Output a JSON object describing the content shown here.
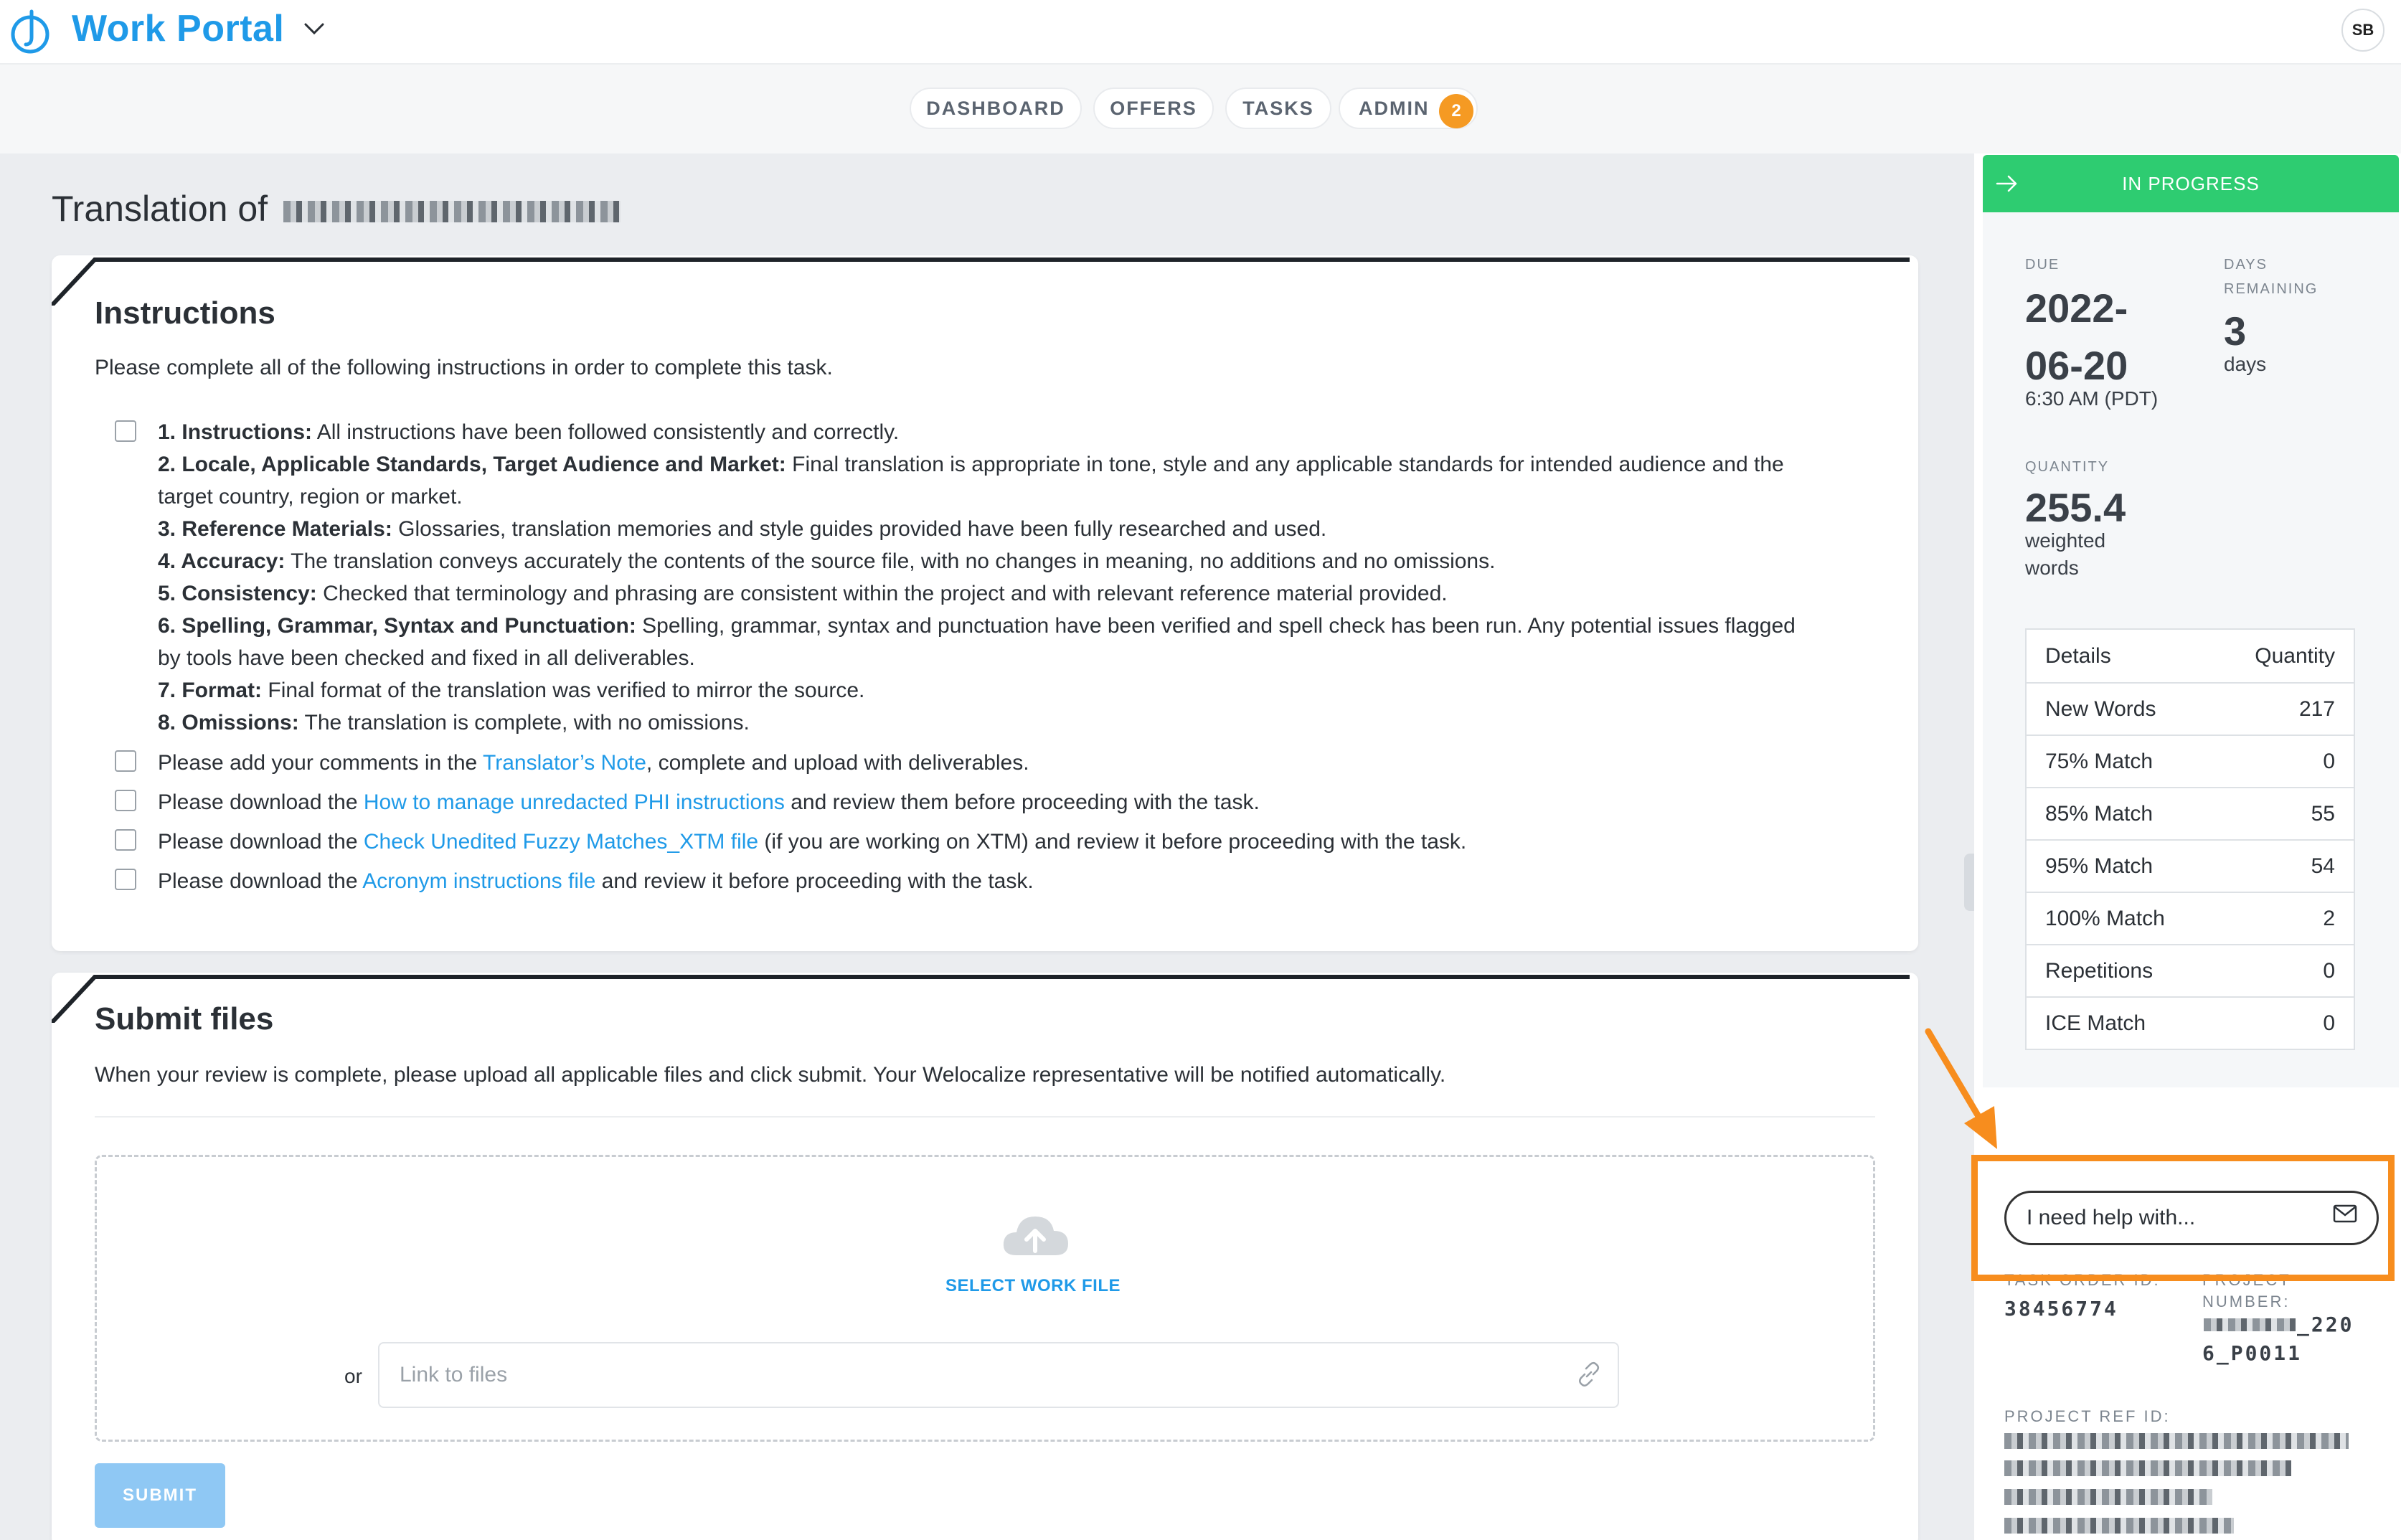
{
  "app": {
    "title": "Work Portal",
    "avatar_initials": "SB"
  },
  "nav": {
    "items": [
      "DASHBOARD",
      "OFFERS",
      "TASKS",
      "ADMIN"
    ],
    "admin_badge": "2"
  },
  "page": {
    "title_prefix": "Translation of"
  },
  "instructions": {
    "heading": "Instructions",
    "lead": "Please complete all of the following instructions in order to complete this task.",
    "checklist": [
      {
        "label": "1. Instructions:",
        "text": "All instructions have been followed consistently and correctly."
      },
      {
        "label": "2. Locale, Applicable Standards, Target Audience and Market:",
        "text": "Final translation is appropriate in tone, style and any applicable standards for intended audience and the"
      },
      {
        "label": "",
        "text": "target country, region or market."
      },
      {
        "label": "3. Reference Materials:",
        "text": "Glossaries, translation memories and style guides provided have been fully researched and used."
      },
      {
        "label": "4. Accuracy:",
        "text": "The translation conveys accurately the contents of the source file, with no changes in meaning, no additions and no omissions."
      },
      {
        "label": "5. Consistency:",
        "text": "Checked that terminology and phrasing  are consistent within the project and with relevant reference material provided."
      },
      {
        "label": "6. Spelling, Grammar, Syntax and Punctuation:",
        "text": "Spelling, grammar, syntax and punctuation have been verified and spell check has been run. Any potential issues flagged"
      },
      {
        "label": "",
        "text": "by tools have been checked and fixed in all deliverables."
      },
      {
        "label": "7. Format:",
        "text": "Final format of the translation was verified to mirror the source."
      },
      {
        "label": "8. Omissions:",
        "text": "The translation is complete, with no omissions."
      }
    ],
    "extra": [
      {
        "before": "Please add your comments in the ",
        "link": "Translator’s Note",
        "after": ", complete and upload with deliverables."
      },
      {
        "before": "Please download the ",
        "link": "How to manage unredacted PHI instructions",
        "after": " and review them before proceeding with the task."
      },
      {
        "before": "Please download the ",
        "link": "Check Unedited Fuzzy Matches_XTM file",
        "after": " (if you are working on XTM) and review it before proceeding with the task."
      },
      {
        "before": "Please download the ",
        "link": "Acronym instructions file",
        "after": " and review it before proceeding with the task."
      }
    ]
  },
  "submit": {
    "heading": "Submit files",
    "lead": "When your review is complete, please upload all applicable files and click submit. Your Welocalize representative will be notified automatically.",
    "select_label": "SELECT WORK FILE",
    "or_label": "or",
    "link_placeholder": "Link to files",
    "submit_label": "SUBMIT"
  },
  "status": {
    "label": "IN PROGRESS",
    "due_label": "DUE",
    "due_date_line1": "2022-",
    "due_date_line2": "06-20",
    "due_time": "6:30 AM (PDT)",
    "days_label_1": "DAYS",
    "days_label_2": "REMAINING",
    "days_value": "3",
    "days_unit": "days",
    "quantity_label": "QUANTITY",
    "quantity_value": "255.4",
    "quantity_unit_1": "weighted",
    "quantity_unit_2": "words"
  },
  "quantity_table": {
    "headers": [
      "Details",
      "Quantity"
    ],
    "rows": [
      [
        "New Words",
        "217"
      ],
      [
        "75% Match",
        "0"
      ],
      [
        "85% Match",
        "55"
      ],
      [
        "95% Match",
        "54"
      ],
      [
        "100% Match",
        "2"
      ],
      [
        "Repetitions",
        "0"
      ],
      [
        "ICE Match",
        "0"
      ]
    ]
  },
  "help": {
    "placeholder": "I need help with..."
  },
  "meta": {
    "task_order_label": "TASK ORDER ID:",
    "task_order_value": "38456774",
    "project_number_label_1": "PROJECT",
    "project_number_label_2": "NUMBER:",
    "project_number_value_1": "_220",
    "project_number_value_2": "6_P0011",
    "project_ref_label": "PROJECT REF ID:"
  },
  "colors": {
    "brand": "#1f9ae8",
    "status_green": "#2ecc71",
    "badge_orange": "#f59a23",
    "annotation_orange": "#f78d1e"
  }
}
